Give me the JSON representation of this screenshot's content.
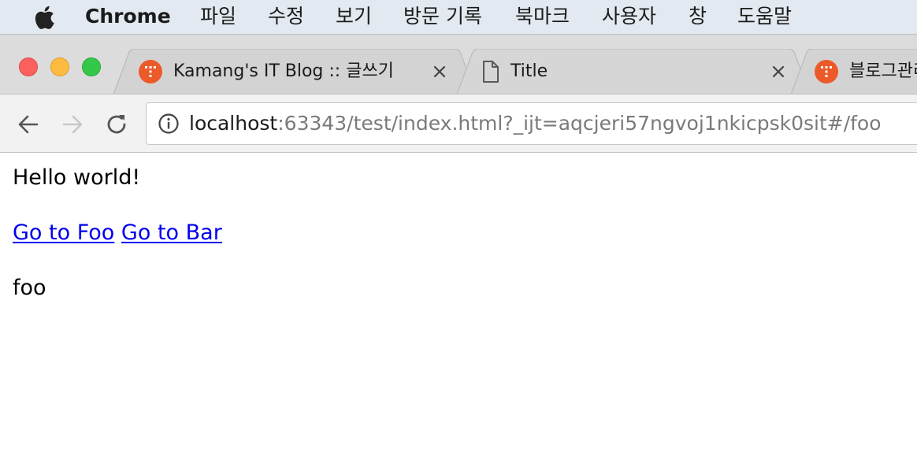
{
  "menubar": {
    "app_name": "Chrome",
    "items": [
      "파일",
      "수정",
      "보기",
      "방문 기록",
      "북마크",
      "사용자",
      "창",
      "도움말"
    ]
  },
  "tabs": [
    {
      "title": "Kamang's IT Blog :: 글쓰기",
      "icon": "tistory-favicon",
      "active": false
    },
    {
      "title": "Title",
      "icon": "document-icon",
      "active": true
    },
    {
      "title": "블로그관리",
      "icon": "tistory-favicon",
      "active": false
    }
  ],
  "toolbar": {
    "url_host": "localhost",
    "url_rest": ":63343/test/index.html?_ijt=aqcjeri57ngvoj1nkicpsk0sit#/foo"
  },
  "page": {
    "heading": "Hello world!",
    "link_foo": "Go to Foo",
    "link_bar": "Go to Bar",
    "view_text": "foo"
  },
  "colors": {
    "menubar_bg": "#e3e9f0",
    "tabstrip_bg": "#dcdcdc",
    "toolbar_bg": "#f2f2f2",
    "link": "#0000ee",
    "favicon": "#ec5a2a"
  }
}
